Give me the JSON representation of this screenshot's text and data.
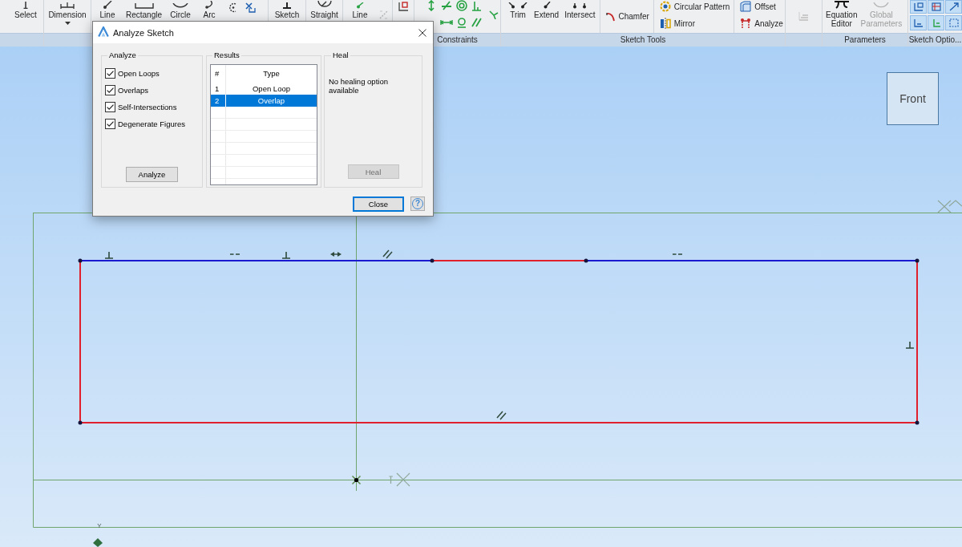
{
  "ribbon": {
    "groups": [
      {
        "tools": [
          {
            "kind": "large",
            "label": "Select",
            "disabled": false
          }
        ]
      },
      {
        "tools": [
          {
            "kind": "large",
            "label": "Dimension",
            "disabled": false,
            "dropdown": true
          }
        ]
      },
      {
        "tools": [
          {
            "kind": "large",
            "label": "Line",
            "disabled": false
          },
          {
            "kind": "large",
            "label": "Rectangle",
            "disabled": false
          },
          {
            "kind": "large",
            "label": "Circle",
            "disabled": false
          },
          {
            "kind": "large",
            "label": "Arc",
            "disabled": false
          },
          {
            "kind": "icons"
          }
        ]
      },
      {
        "tools": [
          {
            "kind": "large",
            "label": "Sketch",
            "disabled": false
          }
        ]
      },
      {
        "tools": [
          {
            "kind": "large",
            "label": "Straight",
            "disabled": false
          }
        ]
      },
      {
        "tools": [
          {
            "kind": "large",
            "label": "Line",
            "disabled": false
          },
          {
            "kind": "icons"
          }
        ]
      },
      {
        "tools": [
          {
            "kind": "icons"
          }
        ]
      },
      {
        "label": "Constraints",
        "tools": [
          {
            "kind": "icons"
          }
        ]
      },
      {
        "label": "Sketch Tools",
        "tools": [
          {
            "kind": "large",
            "label": "Trim",
            "disabled": false
          },
          {
            "kind": "large",
            "label": "Extend",
            "disabled": false
          },
          {
            "kind": "large",
            "label": "Intersect",
            "disabled": false
          },
          {
            "kind": "stack",
            "tools": [
              {
                "label": "Chamfer",
                "disabled": false
              }
            ]
          },
          {
            "kind": "stack",
            "tools": [
              {
                "label": "Circular Pattern",
                "disabled": false
              },
              {
                "label": "Mirror",
                "disabled": false
              }
            ]
          },
          {
            "kind": "stack",
            "tools": [
              {
                "label": "Offset",
                "disabled": false
              },
              {
                "label": "Analyze",
                "disabled": false
              }
            ]
          }
        ]
      },
      {
        "tools": [
          {
            "kind": "icons"
          }
        ]
      },
      {
        "label": "Parameters",
        "tools": [
          {
            "kind": "large",
            "label": "Equation Editor",
            "disabled": false
          },
          {
            "kind": "large",
            "label": "Global Parameters",
            "disabled": true
          }
        ]
      },
      {
        "label": "Sketch Optio...",
        "tools": [
          {
            "kind": "toggles",
            "items": [
              {
                "on": true
              },
              {
                "on": true
              },
              {
                "on": true
              },
              {
                "on": true
              },
              {
                "on": true
              },
              {
                "on": true
              }
            ]
          }
        ]
      }
    ]
  },
  "canvas": {
    "view_cube": {
      "label": "Front"
    },
    "axis_label": "Y"
  },
  "dialog": {
    "title": "Analyze Sketch",
    "analyze": {
      "label": "Analyze",
      "options": [
        {
          "label": "Open Loops",
          "checked": true
        },
        {
          "label": "Overlaps",
          "checked": true
        },
        {
          "label": "Self-Intersections",
          "checked": true
        },
        {
          "label": "Degenerate Figures",
          "checked": true
        }
      ],
      "button": "Analyze"
    },
    "results": {
      "label": "Results",
      "columns": [
        "#",
        "Type"
      ],
      "rows": [
        {
          "cells": [
            "1",
            "Open Loop"
          ],
          "selected": false
        },
        {
          "cells": [
            "2",
            "Overlap"
          ],
          "selected": true
        }
      ]
    },
    "heal": {
      "label": "Heal",
      "message": "No healing option available",
      "button": {
        "label": "Heal",
        "disabled": true
      }
    },
    "close_button": {
      "label": "Close",
      "default": true
    },
    "help_button": {
      "label": "?"
    }
  }
}
